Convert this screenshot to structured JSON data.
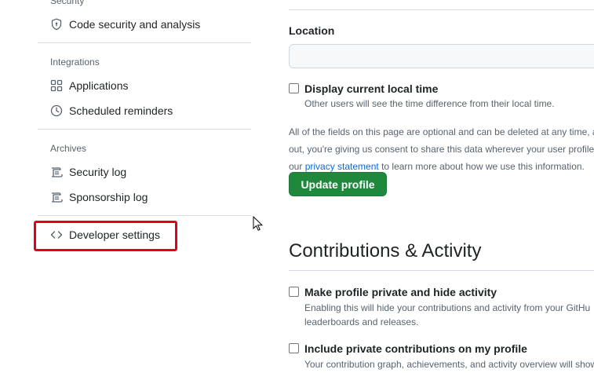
{
  "sidebar": {
    "partial_heading": "Security",
    "security_items": [
      {
        "label": "Code security and analysis",
        "icon": "shield-lock-icon"
      }
    ],
    "integrations_heading": "Integrations",
    "integrations_items": [
      {
        "label": "Applications",
        "icon": "apps-grid-icon"
      },
      {
        "label": "Scheduled reminders",
        "icon": "clock-icon"
      }
    ],
    "archives_heading": "Archives",
    "archives_items": [
      {
        "label": "Security log",
        "icon": "log-icon"
      },
      {
        "label": "Sponsorship log",
        "icon": "log-icon"
      }
    ],
    "developer_settings": {
      "label": "Developer settings",
      "icon": "code-icon"
    },
    "highlight_color": "#e3001b"
  },
  "profile_form": {
    "location_label": "Location",
    "location_value": "",
    "local_time": {
      "label": "Display current local time",
      "checked": false,
      "note": "Other users will see the time difference from their local time."
    },
    "optional_text_line1": "All of the fields on this page are optional and can be deleted at any time, a",
    "optional_text_line2": "out, you're giving us consent to share this data wherever your user profile a",
    "optional_text_line3_prefix": "our ",
    "privacy_link": "privacy statement",
    "optional_text_line3_suffix": " to learn more about how we use this information.",
    "update_button": "Update profile",
    "button_color": "#1f883d"
  },
  "contributions": {
    "heading": "Contributions & Activity",
    "private_profile": {
      "label": "Make profile private and hide activity",
      "checked": false,
      "note_line1": "Enabling this will hide your contributions and activity from your GitHu",
      "note_line2": "leaderboards and releases."
    },
    "private_contributions": {
      "label": "Include private contributions on my profile",
      "checked": false,
      "note_line1": "Your contribution graph, achievements, and activity overview will show"
    }
  }
}
